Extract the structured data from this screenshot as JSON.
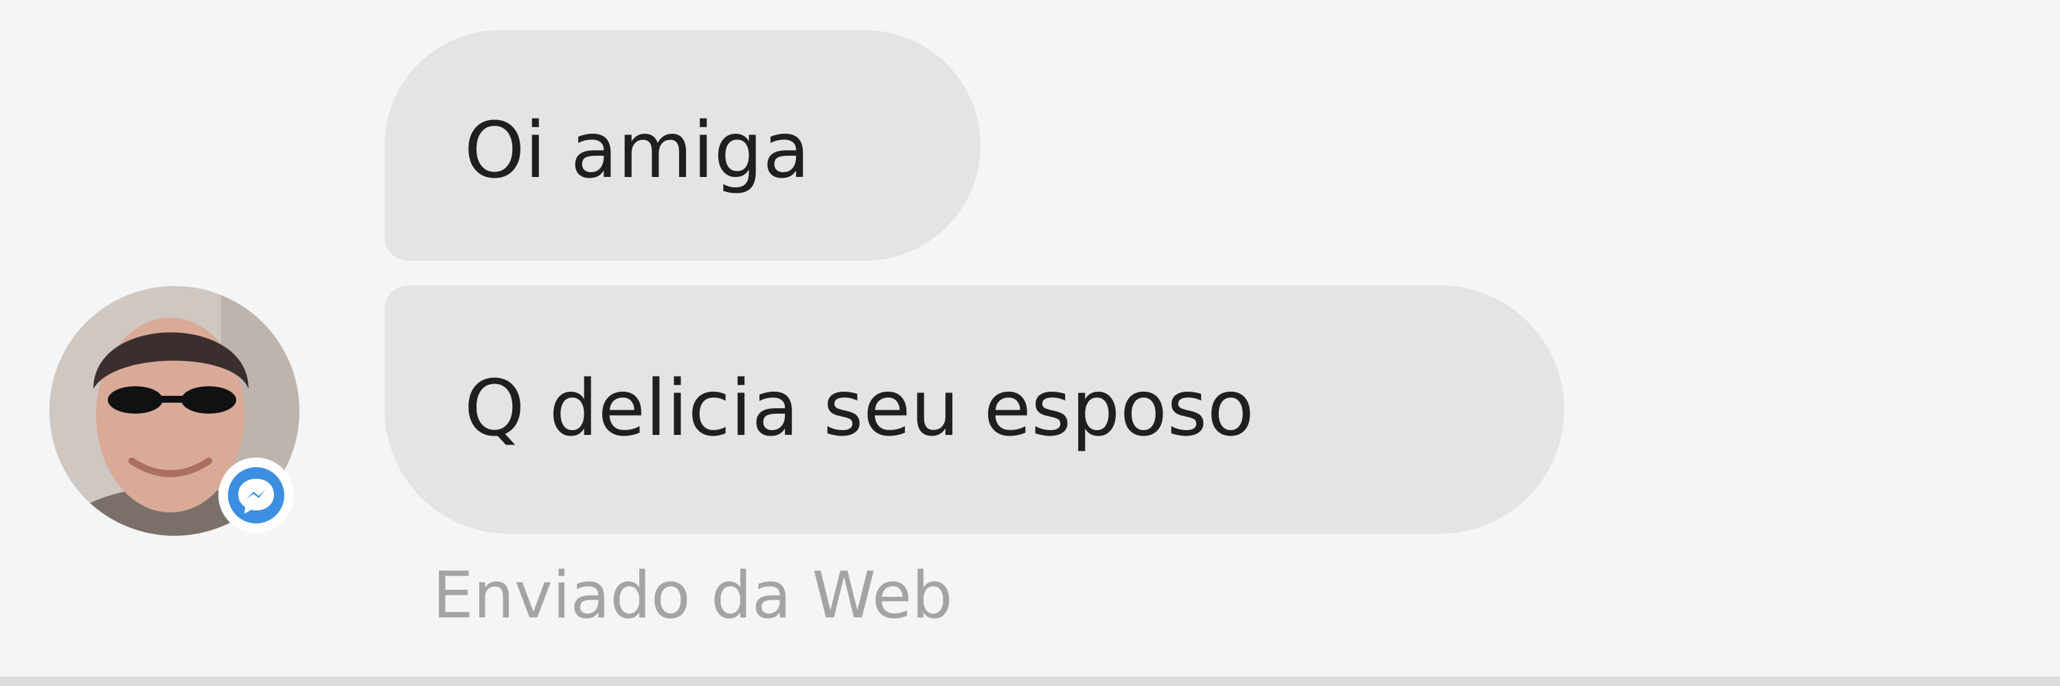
{
  "conversation": {
    "messages": [
      {
        "text": "Oi amiga"
      },
      {
        "text": "Q delicia seu esposo"
      }
    ],
    "sent_via": "Enviado da Web"
  },
  "sender": {
    "avatar_icon": "avatar-photo",
    "badge_icon": "messenger-icon",
    "badge_color": "#3c8fe0"
  },
  "theme": {
    "background": "#f5f5f5",
    "bubble_color": "#e4e4e4",
    "text_color": "#1f1f1f",
    "meta_text_color": "#a4a4a4"
  }
}
